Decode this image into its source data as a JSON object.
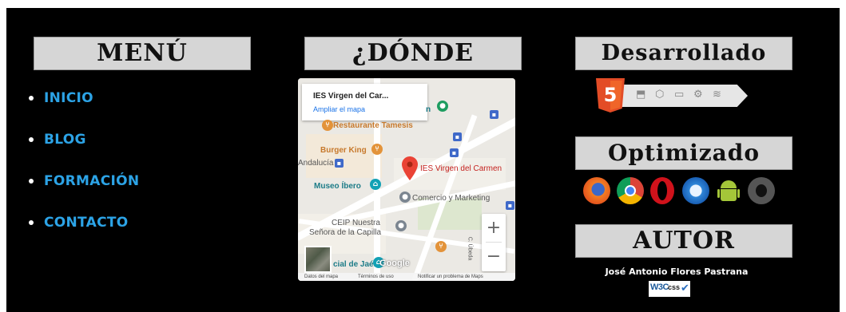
{
  "columns": {
    "menu": {
      "heading": "MENÚ",
      "items": [
        "INICIO",
        "BLOG",
        "FORMACIÓN",
        "CONTACTO"
      ]
    },
    "where": {
      "heading": "¿DÓNDE"
    },
    "developed": {
      "heading": "Desarrollado"
    },
    "optimized": {
      "heading": "Optimizado"
    },
    "author": {
      "heading": "AUTOR",
      "name": "José Antonio Flores Pastrana"
    }
  },
  "map": {
    "place_name": "IES Virgen del Car...",
    "enlarge_link": "Ampliar el mapa",
    "labels": {
      "restaurant": "Restaurante Tamesis",
      "burger": "Burger King",
      "andalucia": "Andalucía",
      "pin_label": "IES Virgen del Carmen",
      "museum": "Museo Íbero",
      "commerce": "Comercio y Marketing",
      "school_1": "CEIP Nuestra",
      "school_2": "Señora de la Capilla",
      "street": "C. Úbeda",
      "jaen": "cial de Jaén",
      "google": "Google",
      "n_label": "n"
    },
    "attribution": [
      "Datos del mapa",
      "Términos de uso",
      "Notificar un problema de Maps"
    ],
    "zoom_in": "+",
    "zoom_out": "−"
  },
  "badges": {
    "html5": "5",
    "w3c": "W3C",
    "css": "css"
  },
  "colors": {
    "background": "#000000",
    "link": "#2ca3e6",
    "heading_bg": "#d6d6d6",
    "html5": "#e34c26"
  },
  "icons": [
    "firefox-icon",
    "chrome-icon",
    "opera-icon",
    "safari-icon",
    "android-icon",
    "apple-icon"
  ]
}
